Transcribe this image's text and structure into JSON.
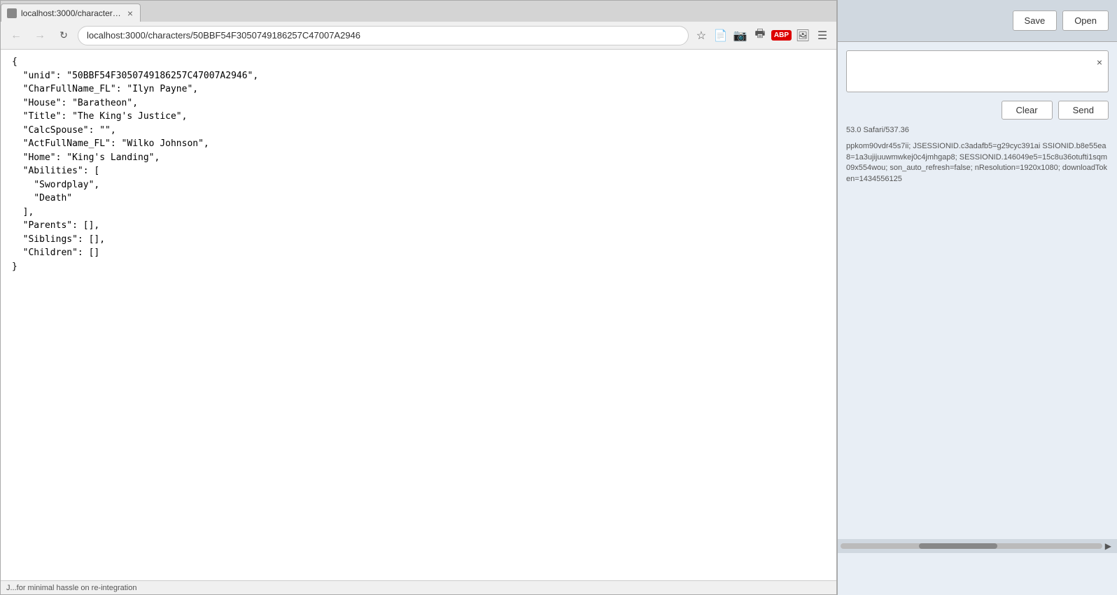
{
  "browser": {
    "tab": {
      "favicon": "globe",
      "title": "localhost:3000/characters...",
      "close": "×"
    },
    "toolbar": {
      "back_disabled": true,
      "forward_disabled": true,
      "url": "localhost:3000/characters/50BBF54F3050749186257C47007A2946"
    },
    "content": {
      "json_text": "{\n  \"unid\": \"50BBF54F3050749186257C47007A2946\",\n  \"CharFullName_FL\": \"Ilyn Payne\",\n  \"House\": \"Baratheon\",\n  \"Title\": \"The King's Justice\",\n  \"CalcSpouse\": \"\",\n  \"ActFullName_FL\": \"Wilko Johnson\",\n  \"Home\": \"King's Landing\",\n  \"Abilities\": [\n    \"Swordplay\",\n    \"Death\"\n  ],\n  \"Parents\": [],\n  \"Siblings\": [],\n  \"Children\": []\n}"
    },
    "status_bar": {
      "text": "J...for minimal hassle on re-integration"
    }
  },
  "right_panel": {
    "top_buttons": {
      "save": "Save",
      "open": "Open"
    },
    "search_close": "×",
    "clear_btn": "Clear",
    "send_btn": "Send",
    "info_text": "53.0 Safari/537.36",
    "cookie_text": "ppkom90vdr45s7ii; JSESSIONID.c3adafb5=g29cyc391ai SSIONID.b8e55ea8=1a3ujijuuwmwkej0c4jmhgap8; SESSIONID.146049e5=15c8u36otufti1sqm09x554wou; son_auto_refresh=false; nResolution=1920x1080; downloadToken=1434556125"
  }
}
